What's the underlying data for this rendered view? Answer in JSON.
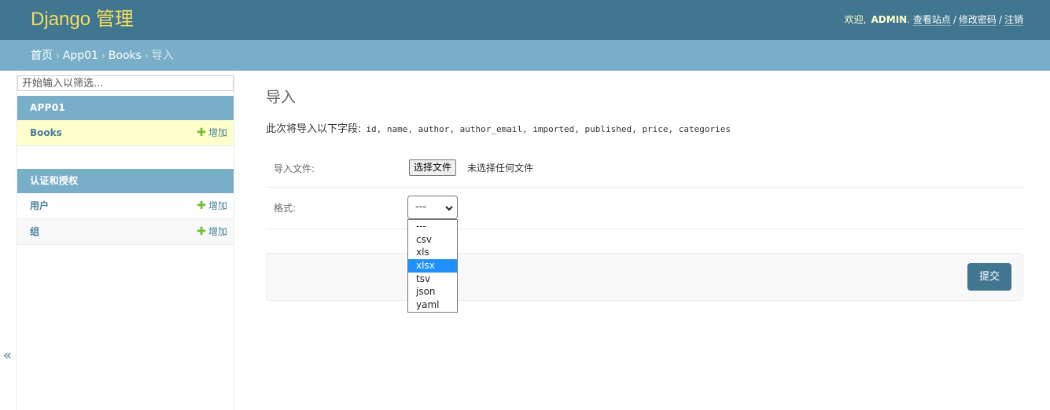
{
  "header": {
    "site_title": "Django 管理",
    "welcome": "欢迎,",
    "username": "ADMIN",
    "view_site": "查看站点",
    "change_password": "修改密码",
    "logout": "注销",
    "separator": "/",
    "dot": "."
  },
  "breadcrumbs": {
    "home": "首页",
    "app": "App01",
    "model": "Books",
    "current": "导入",
    "arrow": "›"
  },
  "sidebar": {
    "toggle_icon": "«",
    "filter_placeholder": "开始输入以筛选...",
    "modules": [
      {
        "caption": "APP01",
        "models": [
          {
            "name": "Books",
            "add_label": "增加",
            "selected": true
          }
        ]
      },
      {
        "caption": "认证和授权",
        "models": [
          {
            "name": "用户",
            "add_label": "增加"
          },
          {
            "name": "组",
            "add_label": "增加"
          }
        ]
      }
    ],
    "plus_glyph": "✚"
  },
  "main": {
    "title": "导入",
    "fields_intro": "此次将导入以下字段:",
    "fields_list": "id, name, author, author_email, imported, published, price, categories",
    "file_label": "导入文件:",
    "file_button": "选择文件",
    "file_status": "未选择任何文件",
    "format_label": "格式:",
    "format_selected": "---",
    "format_options": [
      "---",
      "csv",
      "xls",
      "xlsx",
      "tsv",
      "json",
      "yaml"
    ],
    "format_highlighted": "xlsx",
    "submit_label": "提交"
  },
  "colors": {
    "header_bg": "#417690",
    "breadcrumb_bg": "#79aec8",
    "title_yellow": "#f5dd5d",
    "link_blue": "#447e9b",
    "add_green": "#70bf2b",
    "selected_row": "#ffffcc",
    "highlight": "#1e90ff"
  }
}
